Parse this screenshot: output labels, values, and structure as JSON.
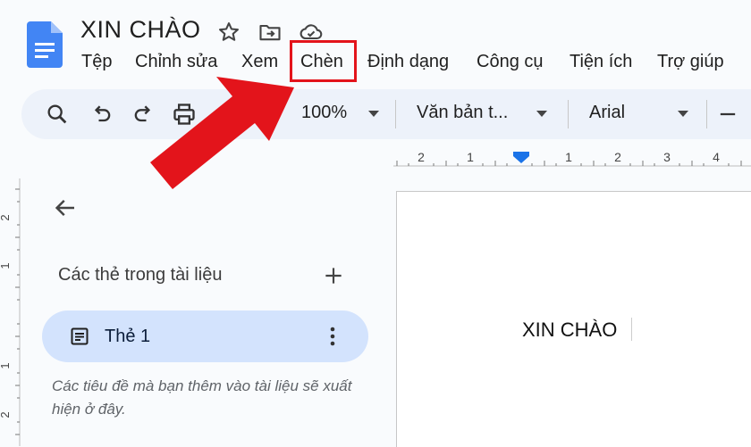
{
  "header": {
    "doc_title": "XIN CHÀO",
    "menu": [
      "Tệp",
      "Chỉnh sửa",
      "Xem",
      "Chèn",
      "Định dạng",
      "Công cụ",
      "Tiện ích",
      "Trợ giúp"
    ],
    "highlighted_menu": "Chèn",
    "highlight_color": "#e3141b"
  },
  "toolbar": {
    "zoom": "100%",
    "style": "Văn bản t...",
    "font": "Arial"
  },
  "ruler": {
    "top_labels": [
      "2",
      "1",
      "1",
      "2",
      "3",
      "4"
    ],
    "left_labels": [
      "2",
      "1",
      "1",
      "2"
    ]
  },
  "side_panel": {
    "heading": "Các thẻ trong tài liệu",
    "tab_label": "Thẻ 1",
    "hint": "Các tiêu đề mà bạn thêm vào tài liệu sẽ xuất hiện ở đây."
  },
  "document": {
    "body_text": "XIN CHÀO"
  },
  "colors": {
    "accent_blue": "#4285f4",
    "tab_pill": "#d3e3fd",
    "arrow_red": "#e3141b"
  }
}
